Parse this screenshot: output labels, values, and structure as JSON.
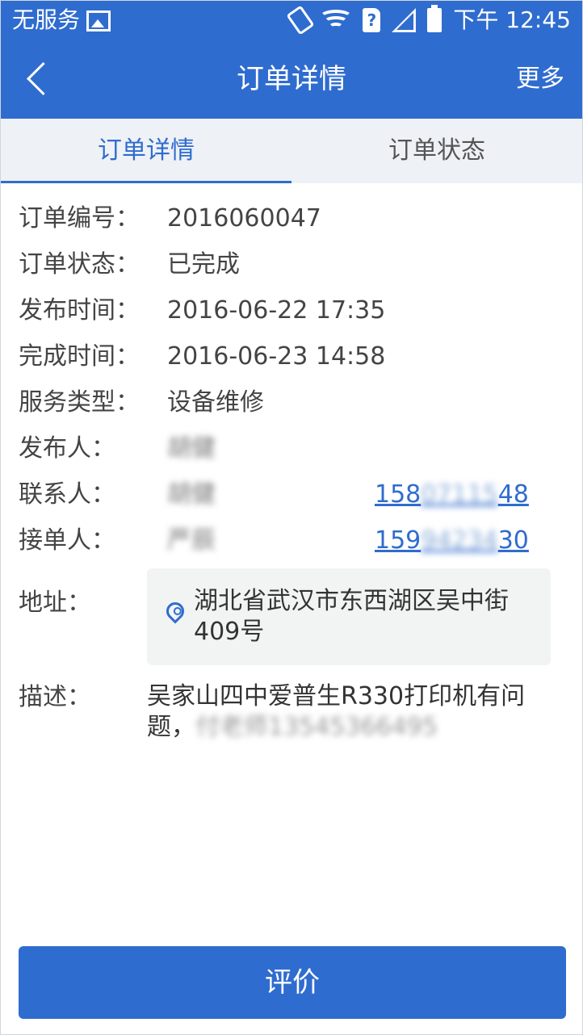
{
  "status_bar": {
    "carrier": "无服务",
    "time": "下午 12:45",
    "icons": [
      "image-icon",
      "vibrate-icon",
      "wifi-icon",
      "sim-icon",
      "signal-icon",
      "battery-icon"
    ]
  },
  "header": {
    "title": "订单详情",
    "more_label": "更多",
    "back_icon": "chevron-left-icon"
  },
  "tabs": [
    {
      "label": "订单详情",
      "active": true
    },
    {
      "label": "订单状态",
      "active": false
    }
  ],
  "details": {
    "order_no": {
      "label": "订单编号：",
      "value": "2016060047"
    },
    "order_status": {
      "label": "订单状态：",
      "value": "已完成"
    },
    "publish_time": {
      "label": "发布时间：",
      "value": "2016-06-22 17:35"
    },
    "finish_time": {
      "label": "完成时间：",
      "value": "2016-06-23 14:58"
    },
    "service_type": {
      "label": "服务类型：",
      "value": "设备维修"
    },
    "publisher": {
      "label": "发布人：",
      "value": "胡健"
    },
    "contact": {
      "label": "联系人：",
      "value": "胡健",
      "phone_prefix": "158",
      "phone_hidden": "07115",
      "phone_suffix": "48"
    },
    "receiver": {
      "label": "接单人：",
      "value": "严辰",
      "phone_prefix": "159",
      "phone_hidden": "94234",
      "phone_suffix": "30"
    },
    "address": {
      "label": "地址：",
      "value": "湖北省武汉市东西湖区吴中街409号"
    },
    "description": {
      "label": "描述：",
      "value_visible": "吴家山四中爱普生R330打印机有问题，",
      "value_hidden": "付老师13545366495"
    }
  },
  "actions": {
    "rate_label": "评价"
  },
  "colors": {
    "primary": "#2f6ccf",
    "tab_bg": "#eef1f5",
    "address_bg": "#f1f4f3"
  }
}
